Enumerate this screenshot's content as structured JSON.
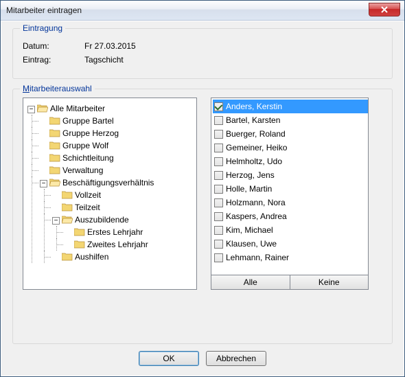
{
  "window": {
    "title": "Mitarbeiter eintragen"
  },
  "registration": {
    "group_label": "Eintragung",
    "date_label": "Datum:",
    "date_value": "Fr 27.03.2015",
    "entry_label": "Eintrag:",
    "entry_value": "Tagschicht"
  },
  "selection": {
    "group_label_prefix": "M",
    "group_label_rest": "itarbeiterauswahl",
    "tree": {
      "root": "Alle Mitarbeiter",
      "groups": [
        "Gruppe Bartel",
        "Gruppe Herzog",
        "Gruppe Wolf",
        "Schichtleitung",
        "Verwaltung"
      ],
      "employment": {
        "label": "Beschäftigungsverhältnis",
        "children_simple": [
          "Vollzeit",
          "Teilzeit"
        ],
        "trainees": {
          "label": "Auszubildende",
          "years": [
            "Erstes Lehrjahr",
            "Zweites Lehrjahr"
          ]
        },
        "last": "Aushilfen"
      }
    },
    "list": [
      {
        "name": "Anders, Kerstin",
        "checked": true,
        "selected": true
      },
      {
        "name": "Bartel, Karsten",
        "checked": false,
        "selected": false
      },
      {
        "name": "Buerger, Roland",
        "checked": false,
        "selected": false
      },
      {
        "name": "Gemeiner, Heiko",
        "checked": false,
        "selected": false
      },
      {
        "name": "Helmholtz, Udo",
        "checked": false,
        "selected": false
      },
      {
        "name": "Herzog, Jens",
        "checked": false,
        "selected": false
      },
      {
        "name": "Holle, Martin",
        "checked": false,
        "selected": false
      },
      {
        "name": "Holzmann, Nora",
        "checked": false,
        "selected": false
      },
      {
        "name": "Kaspers, Andrea",
        "checked": false,
        "selected": false
      },
      {
        "name": "Kim, Michael",
        "checked": false,
        "selected": false
      },
      {
        "name": "Klausen, Uwe",
        "checked": false,
        "selected": false
      },
      {
        "name": "Lehmann, Rainer",
        "checked": false,
        "selected": false
      }
    ],
    "all_button": "Alle",
    "none_button": "Keine"
  },
  "buttons": {
    "ok": "OK",
    "cancel": "Abbrechen"
  },
  "icons": {
    "expander_minus": "−",
    "folder_open_fill": "#f3d673",
    "folder_closed_fill": "#f3d673",
    "folder_stroke": "#b8903a"
  }
}
